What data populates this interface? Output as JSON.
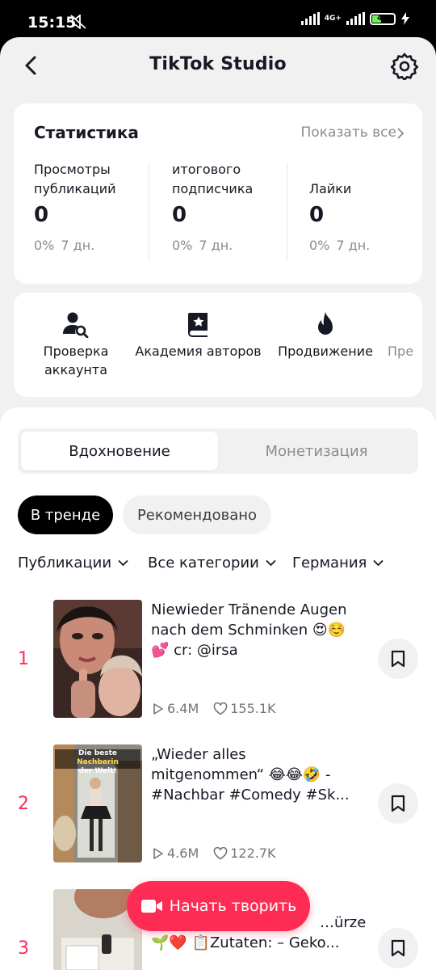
{
  "status_bar": {
    "time": "15:15",
    "network": "4G+",
    "battery": "40",
    "battery_level": 0.4
  },
  "header": {
    "title": "TikTok Studio",
    "icons": [
      "back-arrow-icon",
      "settings-gear-icon"
    ]
  },
  "stats": {
    "heading": "Статистика",
    "show_all": "Показать все",
    "items": [
      {
        "label": "Просмотры публикаций",
        "value": "0",
        "change": "0%",
        "period": "7 дн."
      },
      {
        "label": "итогового подписчика",
        "value": "0",
        "change": "0%",
        "period": "7 дн."
      },
      {
        "label": "Лайки",
        "value": "0",
        "change": "0%",
        "period": "7 дн."
      }
    ]
  },
  "tools": {
    "items": [
      {
        "label_line1": "Проверка",
        "label_line2": "аккаунта",
        "icon": "user-search-icon"
      },
      {
        "label_line1": "Академия авторов",
        "icon": "book-star-icon"
      },
      {
        "label_line1": "Продвижение",
        "icon": "flame-icon"
      },
      {
        "label_line1": "Пре",
        "icon": "none"
      }
    ]
  },
  "tabs": {
    "active": "Вдохновение",
    "inactive": "Монетизация"
  },
  "chips": {
    "trending": "В тренде",
    "recommended": "Рекомендовано"
  },
  "filters": {
    "type": "Публикации",
    "category": "Все категории",
    "region": "Германия"
  },
  "posts": [
    {
      "rank": "1",
      "caption": "Niewieder Tränende Augen nach dem Schminken 😍☺️ 💕 cr: @irsa",
      "views": "6.4M",
      "likes": "155.1K"
    },
    {
      "rank": "2",
      "caption": "„Wieder alles mitgenommen“ 😂😂🤣 - #Nachbar #Comedy #Sk...",
      "views": "4.6M",
      "likes": "122.7K",
      "thumb_text_1": "Die beste",
      "thumb_text_2": "Nachbarin",
      "thumb_text_3": "der Welt!"
    },
    {
      "rank": "3",
      "caption_line1": "…ürze",
      "caption_line2": "🌱❤️ 📋Zutaten: – Geko..."
    }
  ],
  "fab": {
    "label": "Начать творить",
    "icon": "video-camera-icon"
  },
  "colors": {
    "accent": "#fe2c55",
    "text": "#161823",
    "muted": "#8a8b91",
    "background": "#f1f1f2"
  }
}
